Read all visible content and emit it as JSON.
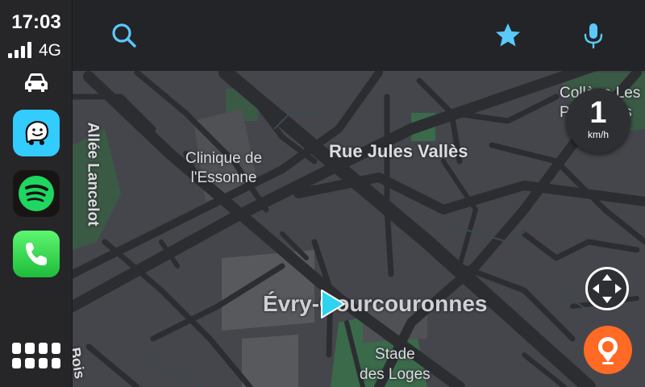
{
  "status": {
    "time": "17:03",
    "network": "4G"
  },
  "sidebar": {
    "apps": [
      {
        "name": "Waze"
      },
      {
        "name": "Spotify"
      },
      {
        "name": "Phone"
      }
    ]
  },
  "map": {
    "labels": {
      "street_allee": "Allée Lancelot",
      "clinique": "Clinique de\nl'Essonne",
      "rue_jules": "Rue Jules Vallès",
      "college": "Collège Les\nPyramides",
      "city": "Évry-Courcouronnes",
      "stade": "Stade\ndes Loges",
      "partial_bottom": "Bois"
    },
    "speed": {
      "value": "1",
      "unit": "km/h"
    }
  },
  "colors": {
    "accent": "#5ac8fa",
    "report": "#ff6a24",
    "waze": "#33ccff",
    "spotify": "#1ed760",
    "phone": "#34c759"
  }
}
